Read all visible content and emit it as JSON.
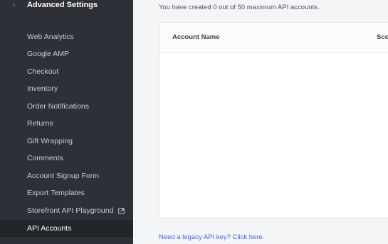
{
  "sidebar": {
    "title": "Advanced Settings",
    "back_icon": "chevron-left-icon",
    "items": [
      {
        "label": "Web Analytics"
      },
      {
        "label": "Google AMP"
      },
      {
        "label": "Checkout"
      },
      {
        "label": "Inventory"
      },
      {
        "label": "Order Notifications"
      },
      {
        "label": "Returns"
      },
      {
        "label": "Gift Wrapping"
      },
      {
        "label": "Comments"
      },
      {
        "label": "Account Signup Form"
      },
      {
        "label": "Export Templates"
      },
      {
        "label": "Storefront API Playground",
        "icon": "external-link-icon"
      },
      {
        "label": "API Accounts",
        "active": true
      }
    ]
  },
  "main": {
    "summary": "You have created 0 out of 50 maximum API accounts.",
    "table": {
      "columns": [
        "Account Name",
        "Sco"
      ]
    },
    "legacy_link": "Need a legacy API key? Click here."
  },
  "colors": {
    "sidebar_bg": "#2d3036",
    "active_bg": "#22252a",
    "link": "#3c64f4"
  }
}
